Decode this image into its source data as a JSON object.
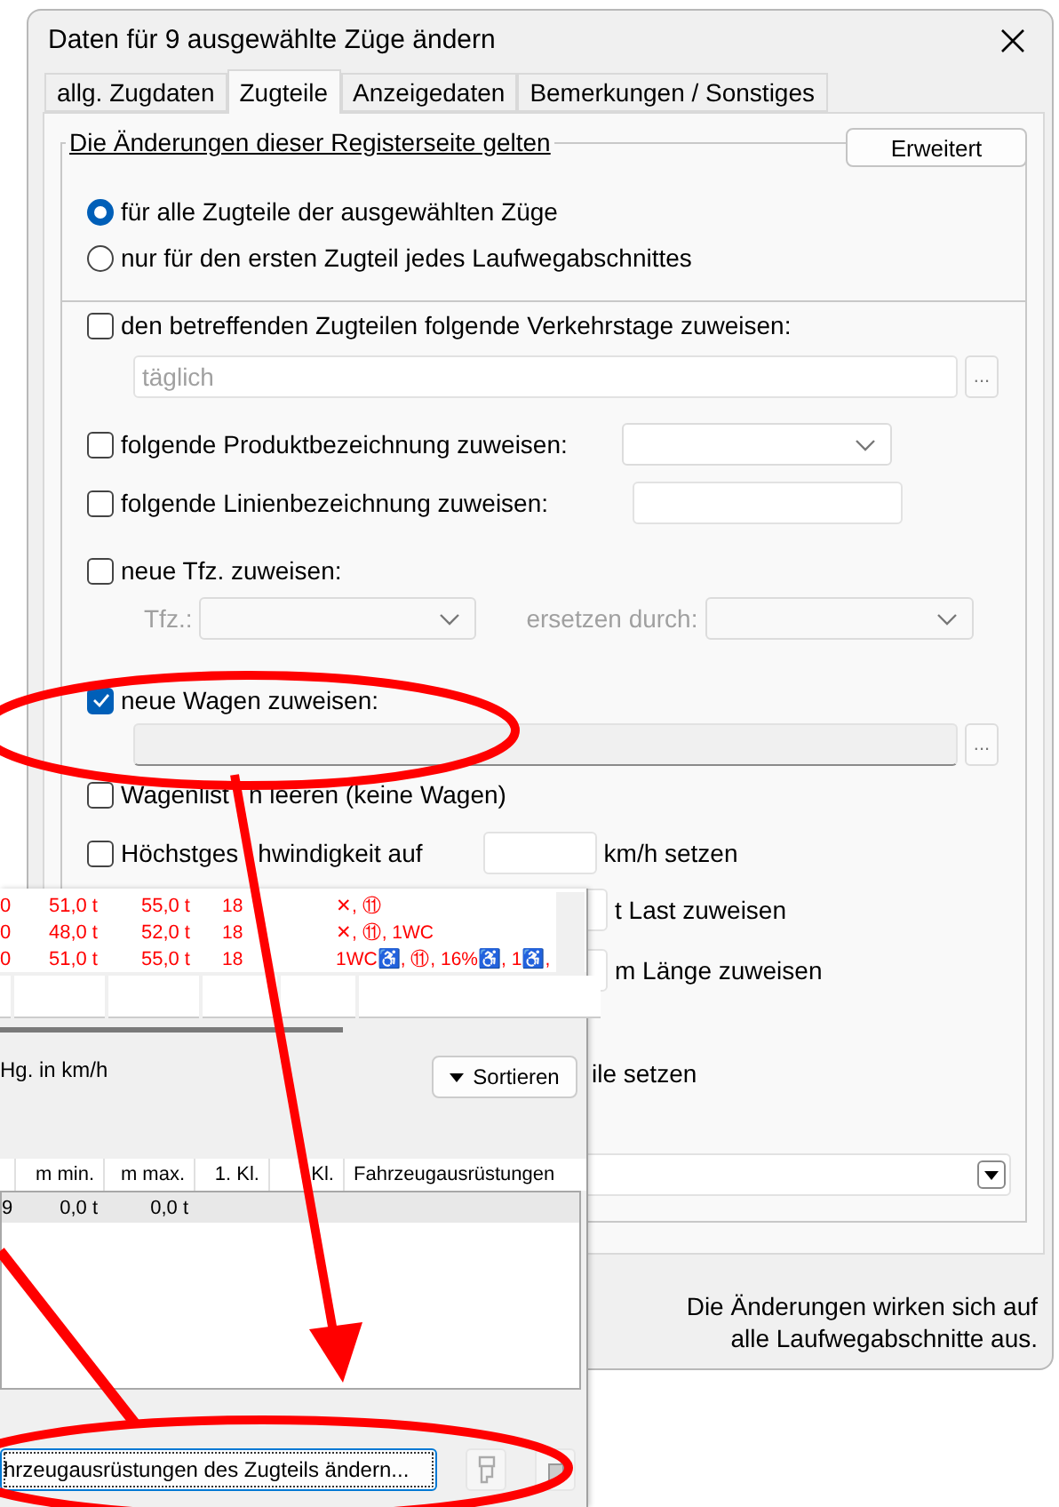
{
  "dialog": {
    "title": "Daten für 9 ausgewählte Züge ändern",
    "tabs": [
      {
        "label": "allg. Zugdaten",
        "selected": false
      },
      {
        "label": "Zugteile",
        "selected": true
      },
      {
        "label": "Anzeigedaten",
        "selected": false
      },
      {
        "label": "Bemerkungen / Sonstiges",
        "selected": false
      }
    ],
    "scope_group": {
      "legend": "Die Änderungen dieser Registerseite gelten",
      "button": "Erweitert",
      "options": [
        {
          "label": "für alle Zugteile der ausgewählten Züge",
          "selected": true
        },
        {
          "label": "nur für den ersten Zugteil jedes Laufwegabschnittes",
          "selected": false
        }
      ]
    },
    "options": [
      {
        "kind": "check",
        "label": "den betreffenden Zugteilen folgende Verkehrstage zuweisen:",
        "checked": false
      },
      {
        "kind": "field",
        "value": "täglich",
        "disabled": true,
        "browse": "..."
      },
      {
        "kind": "check-combo",
        "label": "folgende Produktbezeichnung zuweisen:",
        "checked": false
      },
      {
        "kind": "check-input",
        "label": "folgende Linienbezeichnung zuweisen:",
        "checked": false
      },
      {
        "kind": "check",
        "label": "neue Tfz. zuweisen:",
        "checked": false
      },
      {
        "kind": "combo-pair",
        "label": "Tfz.:",
        "label_2": "ersetzen durch:"
      },
      {
        "kind": "check",
        "label": "neue Wagen zuweisen:",
        "checked": true
      },
      {
        "kind": "field",
        "browse": "..."
      },
      {
        "kind": "check",
        "label_parts": [
          "Wagenlist",
          "n leeren (keine Wagen)"
        ],
        "checked": false
      },
      {
        "kind": "check-input",
        "label_parts": [
          "Höchstges",
          "hwindigkeit auf"
        ],
        "checked": false,
        "unit": "km/h setzen"
      },
      {
        "kind": "input",
        "unit": "t Last zuweisen"
      },
      {
        "kind": "input",
        "unit": "m Länge zuweisen"
      },
      {
        "kind": "text",
        "label": "ile setzen"
      },
      {
        "kind": "dropdown"
      }
    ],
    "footer": [
      "Die Änderungen wirken sich auf",
      "alle Laufwegabschnitte aus."
    ]
  },
  "overlay_window": {
    "top_rows": [
      {
        "highlighted": true,
        "cells": [
          "0",
          "51,0 t",
          "55,0 t",
          "18",
          "✕, ⑪"
        ]
      },
      {
        "highlighted": true,
        "cells": [
          "0",
          "48,0 t",
          "52,0 t",
          "18",
          "✕, ⑪, 1WC"
        ]
      },
      {
        "highlighted": true,
        "cells": [
          "0",
          "51,0 t",
          "55,0 t",
          "18",
          "1WC♿, ⑪, 16%♿, 1♿,"
        ]
      }
    ],
    "speed_label": "Hg. in km/h",
    "sort_button": "Sortieren",
    "table": {
      "columns": [
        "",
        "m min.",
        "m max.",
        "1. Kl.",
        "Kl.",
        "Fahrzeugausrüstungen"
      ],
      "rows": [
        {
          "selected": true,
          "cells": [
            "9",
            "0,0 t",
            "0,0 t"
          ]
        }
      ]
    },
    "edit_button": "hrzeugausrüstungen des Zugteils ändern..."
  }
}
